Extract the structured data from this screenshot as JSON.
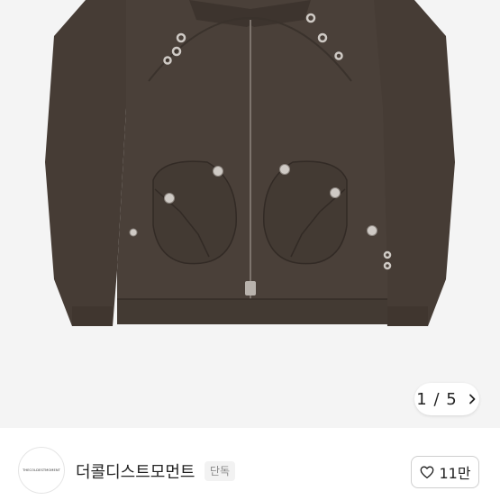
{
  "hero": {
    "image_alt": "brown work jacket with eyelet details",
    "pager": {
      "counter": "1 / 5",
      "next_icon": "chevron-right-icon"
    }
  },
  "seller": {
    "logo_text": "THECOLDESTMOMENT",
    "name": "더콜디스트모먼트",
    "tag": "단독"
  },
  "like": {
    "icon": "heart-outline-icon",
    "count": "11만"
  },
  "colors": {
    "jacket": "#4a4039",
    "jacket_shadow": "#3a322c",
    "hero_bg": "#f4f4f4",
    "border": "#cfcfcf"
  }
}
